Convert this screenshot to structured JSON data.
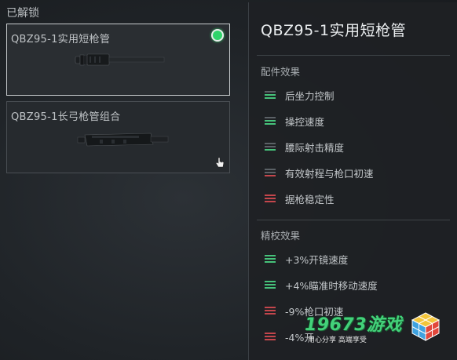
{
  "section_label": "已解锁",
  "cards": [
    {
      "title": "QBZ95-1实用短枪管",
      "selected": true
    },
    {
      "title": "QBZ95-1长弓枪管组合",
      "selected": false
    }
  ],
  "panel": {
    "title": "QBZ95-1实用短枪管",
    "attachment_heading": "配件效果",
    "attachment_stats": [
      {
        "label": "后坐力控制",
        "trend": "positive"
      },
      {
        "label": "操控速度",
        "trend": "positive"
      },
      {
        "label": "腰际射击精度",
        "trend": "positive"
      },
      {
        "label": "有效射程与枪口初速",
        "trend": "negative"
      },
      {
        "label": "据枪稳定性",
        "trend": "negative"
      }
    ],
    "tuning_heading": "精校效果",
    "tuning_stats": [
      {
        "label": "+3%开镜速度",
        "trend": "positive"
      },
      {
        "label": "+4%瞄准时移动速度",
        "trend": "positive"
      },
      {
        "label": "-9%枪口初速",
        "trend": "negative"
      },
      {
        "label": "-4%开",
        "trend": "negative"
      }
    ]
  },
  "watermark": {
    "brand": "19673游戏",
    "slogan": "用心分享 高端享受"
  },
  "colors": {
    "positive": "#46c27a",
    "negative": "#c4464c",
    "neutral": "#5b6166",
    "status_dot": "#2fd36a"
  }
}
